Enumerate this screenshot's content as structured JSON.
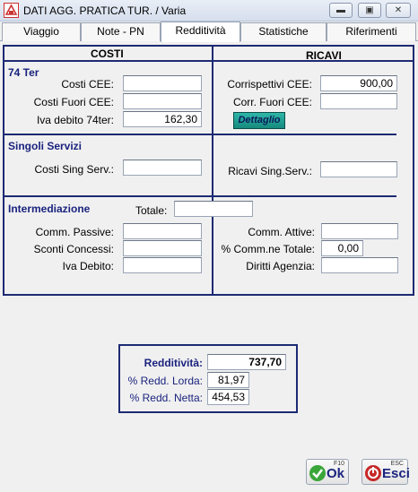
{
  "window": {
    "title": "DATI AGG. PRATICA TUR. / Varia"
  },
  "tabs": [
    {
      "label": "Viaggio"
    },
    {
      "label": "Note - PN"
    },
    {
      "label": "Redditività"
    },
    {
      "label": "Statistiche"
    },
    {
      "label": "Riferimenti"
    }
  ],
  "active_tab": "Redditività",
  "costi": {
    "header": "COSTI",
    "section_74ter": "74 Ter",
    "costi_cee": {
      "label": "Costi CEE:",
      "value": ""
    },
    "costi_fuori_cee": {
      "label": "Costi Fuori CEE:",
      "value": ""
    },
    "iva_debito_74ter": {
      "label": "Iva debito 74ter:",
      "value": "162,30"
    },
    "section_singoli": "Singoli Servizi",
    "costi_sing_serv": {
      "label": "Costi Sing Serv.:",
      "value": ""
    },
    "section_intermed": "Intermediazione",
    "totale": {
      "label": "Totale:",
      "value": ""
    },
    "comm_passive": {
      "label": "Comm. Passive:",
      "value": ""
    },
    "sconti_concessi": {
      "label": "Sconti Concessi:",
      "value": ""
    },
    "iva_debito": {
      "label": "Iva Debito:",
      "value": ""
    }
  },
  "ricavi": {
    "header": "RICAVI",
    "corrispettivi_cee": {
      "label": "Corrispettivi CEE:",
      "value": "900,00"
    },
    "corr_fuori_cee": {
      "label": "Corr. Fuori CEE:",
      "value": ""
    },
    "dettaglio_label": "Dettaglio",
    "ricavi_sing_serv": {
      "label": "Ricavi Sing.Serv.:",
      "value": ""
    },
    "comm_attive": {
      "label": "Comm. Attive:",
      "value": ""
    },
    "perc_comm_totale": {
      "label": "% Comm.ne Totale:",
      "value": "0,00"
    },
    "diritti_agenzia": {
      "label": "Diritti Agenzia:",
      "value": ""
    }
  },
  "summary": {
    "redditivita": {
      "label": "Redditività:",
      "value": "737,70"
    },
    "redd_lorda": {
      "label": "% Redd. Lorda:",
      "value": "81,97"
    },
    "redd_netta": {
      "label": "% Redd. Netta:",
      "value": "454,53"
    }
  },
  "footer": {
    "ok": {
      "label": "Ok",
      "key": "F10"
    },
    "esci": {
      "label": "Esci",
      "key": "ESC"
    }
  },
  "colors": {
    "frame": "#1e2a73",
    "accent_text": "#1a237e",
    "dettaglio_bg": "#1fa193"
  }
}
